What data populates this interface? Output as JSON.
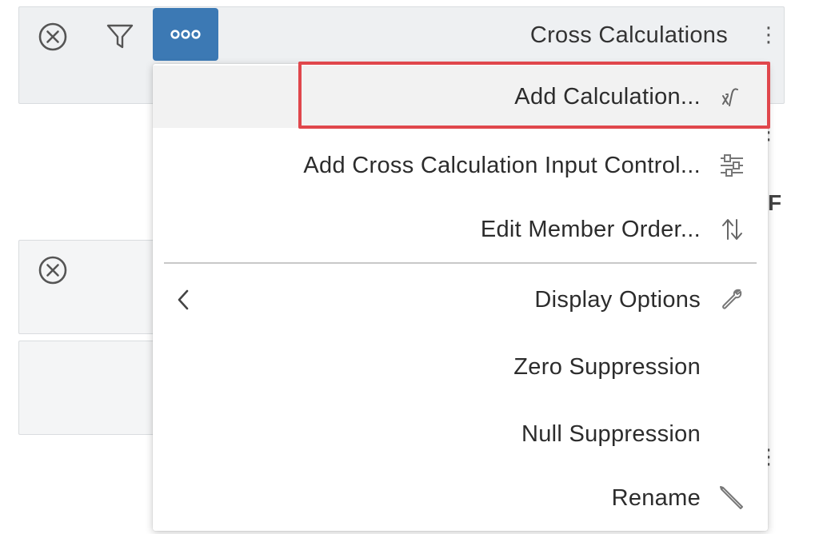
{
  "header": {
    "title": "Cross Calculations",
    "close_icon": "close-circle-icon",
    "filter_icon": "filter-icon",
    "more_icon": "more-horizontal-icon"
  },
  "side_label": "F",
  "menu": {
    "items": [
      {
        "label": "Add Calculation...",
        "icon": "function-fx-icon",
        "highlighted": true
      },
      {
        "label": "Add Cross Calculation Input Control...",
        "icon": "sliders-icon"
      },
      {
        "label": "Edit Member Order...",
        "icon": "sort-arrows-icon"
      },
      {
        "label": "Display Options",
        "icon": "wrench-icon",
        "submenu": true
      },
      {
        "label": "Zero Suppression"
      },
      {
        "label": "Null Suppression"
      },
      {
        "label": "Rename",
        "icon": "pencil-icon"
      }
    ]
  },
  "colors": {
    "accent": "#3c79b4",
    "highlight_border": "#e0474c",
    "panel_bg": "#eef0f2"
  }
}
